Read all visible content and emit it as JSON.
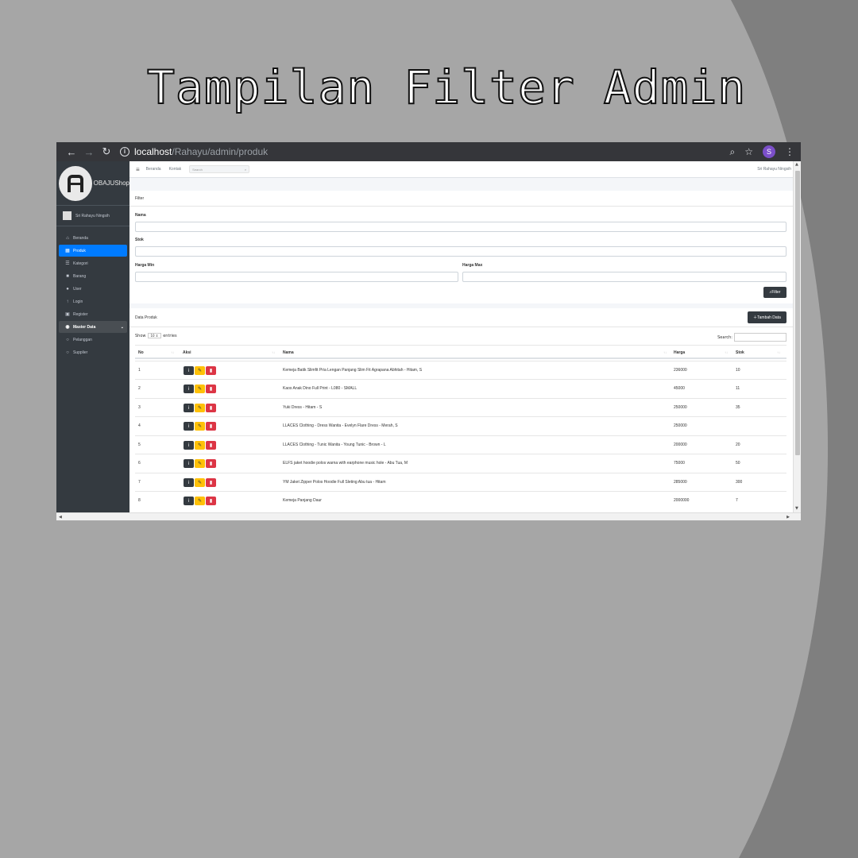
{
  "slide": {
    "title": "Tampilan Filter Admin"
  },
  "browser": {
    "url_host": "localhost",
    "url_path": "/Rahayu/admin/produk",
    "profile_initial": "S"
  },
  "sidebar": {
    "brand": "OBAJUShop",
    "user": "Sri Rahayu Ningsih",
    "items": [
      {
        "label": "Beranda",
        "icon": "home-icon"
      },
      {
        "label": "Produk",
        "icon": "table-icon"
      },
      {
        "label": "Kategori",
        "icon": "list-icon"
      },
      {
        "label": "Barang",
        "icon": "box-icon"
      },
      {
        "label": "User",
        "icon": "users-icon"
      },
      {
        "label": "Login",
        "icon": "login-icon"
      },
      {
        "label": "Register",
        "icon": "register-icon"
      },
      {
        "label": "Master Data",
        "icon": "database-icon"
      },
      {
        "label": "Pelanggan",
        "icon": "circle-icon"
      },
      {
        "label": "Supplier",
        "icon": "circle-icon"
      }
    ]
  },
  "topbar": {
    "links": [
      "Beranda",
      "Kontak"
    ],
    "search_placeholder": "Search",
    "user": "Sri Rahayu Ningsih"
  },
  "filter": {
    "title": "Filter",
    "nama_label": "Nama",
    "stok_label": "Stok",
    "harga_min_label": "Harga Min",
    "harga_max_label": "Harga Max",
    "button": "Filter"
  },
  "data_produk": {
    "title": "Data Produk",
    "add_button": "Tambah Data",
    "show_label": "Show",
    "entries_value": "10",
    "entries_label": "entries",
    "search_label": "Search:",
    "columns": [
      "No",
      "Aksi",
      "Nama",
      "Harga",
      "Stok"
    ],
    "rows": [
      {
        "no": "1",
        "nama": "Kemeja Batik Slimfit Pria Lengan Panjang Slim Fit Agrapana Abhitah - Hitam, S",
        "harga": "236000",
        "stok": "10"
      },
      {
        "no": "2",
        "nama": "Kaos Anak Dino Full Print - L080 - SMALL",
        "harga": "45000",
        "stok": "11"
      },
      {
        "no": "3",
        "nama": "Yuki Dress - Hitam - S",
        "harga": "250000",
        "stok": "35"
      },
      {
        "no": "4",
        "nama": "LLACES Clothing - Dress Wanita - Evelyn Flare Dress - Merah, S",
        "harga": "250000",
        "stok": ""
      },
      {
        "no": "5",
        "nama": "LLACES Clothing - Tunic Wanita - Young Tunic - Brown - L",
        "harga": "200000",
        "stok": "20"
      },
      {
        "no": "6",
        "nama": "ELFS jaket hoodie polos warna with earphone music hole - Abu Tua, M",
        "harga": "75000",
        "stok": "50"
      },
      {
        "no": "7",
        "nama": "YM Jaket Zipper Polos Hoodie Full Sleting Abu tua - Hitam",
        "harga": "285000",
        "stok": "300"
      },
      {
        "no": "8",
        "nama": "Kemeja Panjang Daur",
        "harga": "2000000",
        "stok": "7"
      }
    ]
  },
  "colors": {
    "primary": "#007bff",
    "dark": "#343a40",
    "warning": "#ffc107",
    "danger": "#dc3545",
    "slide_bg": "#a6a6a6",
    "slide_curve": "#7f7f7f"
  }
}
